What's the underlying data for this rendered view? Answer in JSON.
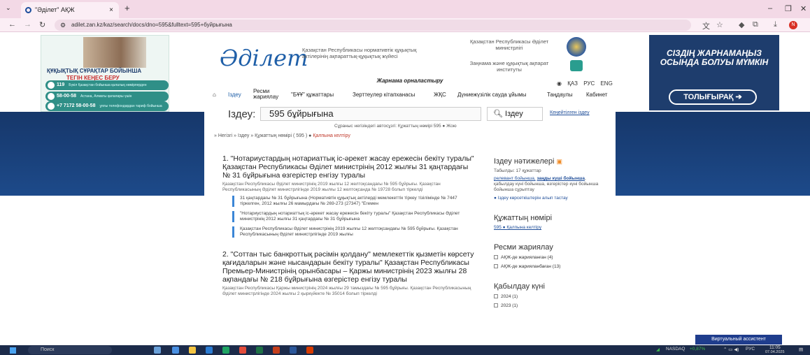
{
  "browser": {
    "tab_title": "\"Әділет\" АҚЖ",
    "tab_close": "×",
    "new_tab": "+",
    "url": "adilet.zan.kz/kaz/search/docs/dno=595&fulltext=595+буйрығына",
    "controls": {
      "minimize": "–",
      "restore": "❐",
      "close": "✕"
    },
    "badge": "N"
  },
  "ad_left": {
    "title1": "ҚҰҚЫҚТЫҚ СҰРАҚТАР БОЙЫНША",
    "title2": "ТЕГІН КЕҢЕС БЕРУ",
    "lines": [
      {
        "num": "119",
        "text": "Бүкіл Қазақстан бойынша қалалық нөмірлерден"
      },
      {
        "num": "58-00-58",
        "text": "Астана, Алматы қалалары үшін"
      },
      {
        "num": "+7 7172 58-00-58",
        "text": "ұялы телефондардан тариф бойынша"
      }
    ]
  },
  "logo": {
    "wordmark": "Әділет",
    "desc": "Қазақстан Республикасы нормативтік құқықтық актілерінің ақпараттық-құқықтық жүйесі"
  },
  "header_right": {
    "ministry": "Қазақстан Республикасы Әділет министрлігі",
    "institute": "Заңнама және құқықтық ақпарат институты"
  },
  "ad_right": {
    "text": "СІЗДІҢ ЖАРНАМАҢЫЗ ОСЫНДА БОЛУЫ МҮМКІН",
    "button": "ТОЛЫҒЫРАҚ"
  },
  "adstrip": "Жарнама орналастыру",
  "languages": [
    "ҚАЗ",
    "РУС",
    "ENG"
  ],
  "menu": [
    "Іздеу",
    "Ресми жариялау",
    "\"БҰҰ\" құжаттары",
    "Зерттеулер кітапханасы",
    "ЖҚС",
    "Дүниежүзілік сауда ұйымы",
    "Таңдаулы",
    "Кабинет"
  ],
  "search": {
    "label": "Іздеу:",
    "value": "595 бұйрығына",
    "button": "Іздеу",
    "advanced": "Кеңейтілген іздеу",
    "hint": "Сұраныс негізіндегі автоcұзгі: Құжаттың нөмірі 595 ● Жою"
  },
  "breadcrumb": {
    "path": "» Негізгі » Іздеу » Құжаттың нөмірі ( 595 ) ●",
    "reset": "Қалпына келтіру"
  },
  "results": [
    {
      "title": "1. \"Нотариустардың нотариаттық іс-әрекет жасау ережесін бекіту туралы\" Қазақстан Республикасы Әділет министрінің 2012 жылғы 31 қаңтардағы № 31 бұйрығына өзгерістер енгізу туралы",
      "desc": "Қазақстан Республикасы Әділет министрінің 2019 жылғы 12 желтоқсандағы № 595 бұйрығы. Қазақстан Республикасының Әділет министрлігінде 2019 жылғы 12 желтоқсанда № 19728 болып тіркелді",
      "snippets": [
        "31 қаңтардағы № 31 бұйрығына (Нормативтік құқықтық актілерді мемлекеттік тіркеу тізілімінде № 7447 тіркелген, 2012 жылғы 26 мамырдағы № 269-273 (27347) \"Егемен",
        "\"Нотариустардың нотариаттық іс-әрекет жасау ережесін бекіту туралы\" Қазақстан Республикасы Әділет министрінің 2012 жылғы 31 қаңтардағы № 31 бұйрығына",
        "Қазақстан Республикасы Әділет министрінің 2019 жылғы 12 желтоқсандағы № 595 бұйрығы. Қазақстан Республикасының Әділет министрлігінде 2019 жылғы"
      ]
    },
    {
      "title": "2. \"Соттан тыс банкроттық рәсімін қолдану\" мемлекеттік қызметін көрсету қағидаларын және нысандарын бекіту туралы\" Қазақстан Республикасы Премьер-Министрінің орынбасары – Қаржы министрінің 2023 жылғы 28 ақпандағы № 218 бұйрығына өзгерістер енгізу туралы",
      "desc": "Қазақстан Республикасы Қаржы министрінің 2024 жылғы 29 тамыздағы № 595 бұйрығы. Қазақстан Республикасының Әділет министрлігінде 2024 жылғы 2 қыркүйекте № 35014 болып тіркелді"
    }
  ],
  "sidebar": {
    "results_title": "Іздеу нәтижелері",
    "found": "Табылды: 17 құжаттар",
    "sort_prefix": "релевант бойынша,",
    "sort_active": "заңды күші бойынша",
    "sort_rest": ", қабылдау күні бойынша, өзгерістер күні бойынша бойынша сұрыптау",
    "hide_link": "● Іздеу көрсеткіштерін алып тастау",
    "doc_number_title": "Құжаттың нөмірі",
    "doc_number_value": "595 ● Қалпына келтіру",
    "official_title": "Ресми жариялау",
    "official_options": [
      "АҚЖ-де жарияланған (4)",
      "АҚЖ-де жарияланбаған (13)"
    ],
    "date_title": "Қабылдау күні",
    "years": [
      "2024 (1)",
      "2023 (1)"
    ]
  },
  "assistant": "Виртуальный ассистент",
  "taskbar": {
    "search": "Поиск",
    "ticker": "NASDAQ",
    "ticker_change": "+0,87%",
    "lang": "РУС",
    "time": "11:05",
    "date": "07.04.2025"
  }
}
